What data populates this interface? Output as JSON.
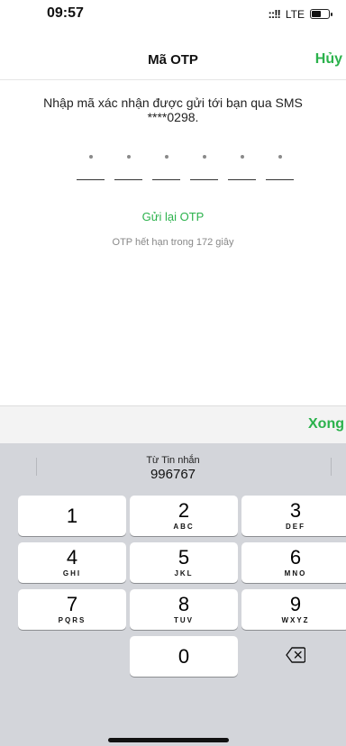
{
  "status": {
    "time": "09:57",
    "signal": "::!!",
    "network": "LTE",
    "battery_level": 0.6
  },
  "nav": {
    "title": "Mã OTP",
    "cancel_label": "Hủy"
  },
  "instruction": {
    "line1": "Nhập mã xác nhận được gửi tới bạn qua SMS",
    "line2": "****0298."
  },
  "otp": {
    "slots": [
      "•",
      "•",
      "•",
      "•",
      "•",
      "•"
    ]
  },
  "resend_label": "Gửi lại OTP",
  "expire_text": "OTP hết hạn trong 172 giây",
  "accessory": {
    "done_label": "Xong"
  },
  "keyboard": {
    "suggestion_label": "Từ Tin nhắn",
    "suggestion_value": "996767",
    "keys": [
      {
        "num": "1",
        "letters": ""
      },
      {
        "num": "2",
        "letters": "ABC"
      },
      {
        "num": "3",
        "letters": "DEF"
      },
      {
        "num": "4",
        "letters": "GHI"
      },
      {
        "num": "5",
        "letters": "JKL"
      },
      {
        "num": "6",
        "letters": "MNO"
      },
      {
        "num": "7",
        "letters": "PQRS"
      },
      {
        "num": "8",
        "letters": "TUV"
      },
      {
        "num": "9",
        "letters": "WXYZ"
      },
      {
        "num": "0",
        "letters": ""
      }
    ],
    "backspace_icon": "backspace-icon"
  },
  "colors": {
    "accent": "#2bb24c",
    "keyboard_bg": "#d3d5da"
  }
}
